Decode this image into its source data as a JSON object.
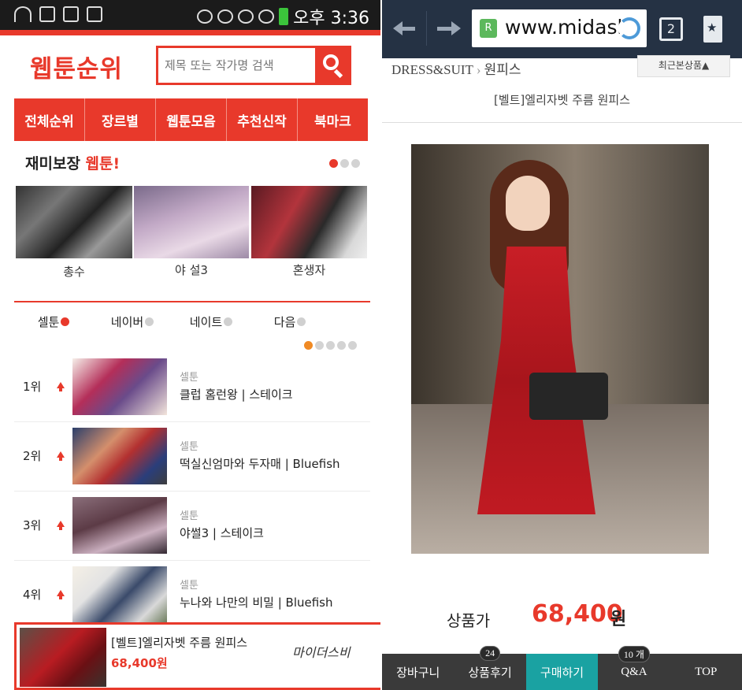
{
  "left": {
    "status_time": "오후 3:36",
    "brand": "웹툰순위",
    "search": {
      "placeholder": "제목 또는 작가명 검색"
    },
    "nav": [
      "전체순위",
      "장르별",
      "웹툰모음",
      "추천신작",
      "북마크"
    ],
    "promo": {
      "title_prefix": "재미보장 ",
      "title_accent": "웹툰!"
    },
    "featured": [
      {
        "caption": "총수"
      },
      {
        "caption": "야 설3"
      },
      {
        "caption": "혼생자"
      }
    ],
    "platforms": [
      "셀툰",
      "네이버",
      "네이트",
      "다음"
    ],
    "rankings": [
      {
        "rank": "1위",
        "platform": "셀툰",
        "title": "클럽 홈런왕 | 스테이크"
      },
      {
        "rank": "2위",
        "platform": "셀툰",
        "title": "떡실신엄마와 두자매 | Bluefish"
      },
      {
        "rank": "3위",
        "platform": "셀툰",
        "title": "야썰3 | 스테이크"
      },
      {
        "rank": "4위",
        "platform": "셀툰",
        "title": "누나와 나만의 비밀 | Bluefish"
      }
    ],
    "ad": {
      "title": "[벨트]엘리자벳 주름 원피스",
      "price": "68,400원",
      "brand": "마이더스비"
    }
  },
  "right": {
    "url": "www.midasb",
    "tab_count": "2",
    "breadcrumb": {
      "category": "DRESS&SUIT",
      "sub": "원피스"
    },
    "recent_label": "최근본상품▲",
    "product_title": "[벨트]엘리자벳 주름 원피스",
    "price_label": "상품가",
    "price_value": "68,400",
    "price_unit": "원",
    "tabs": [
      {
        "label": "장바구니",
        "badge": ""
      },
      {
        "label": "상품후기",
        "badge": "24"
      },
      {
        "label": "구매하기",
        "badge": ""
      },
      {
        "label": "Q&A",
        "badge": "10 개"
      },
      {
        "label": "TOP",
        "badge": ""
      }
    ]
  },
  "colors": {
    "accent_red": "#e8392b",
    "browser_bar": "#253244",
    "buy_teal": "#1aa2a2"
  }
}
